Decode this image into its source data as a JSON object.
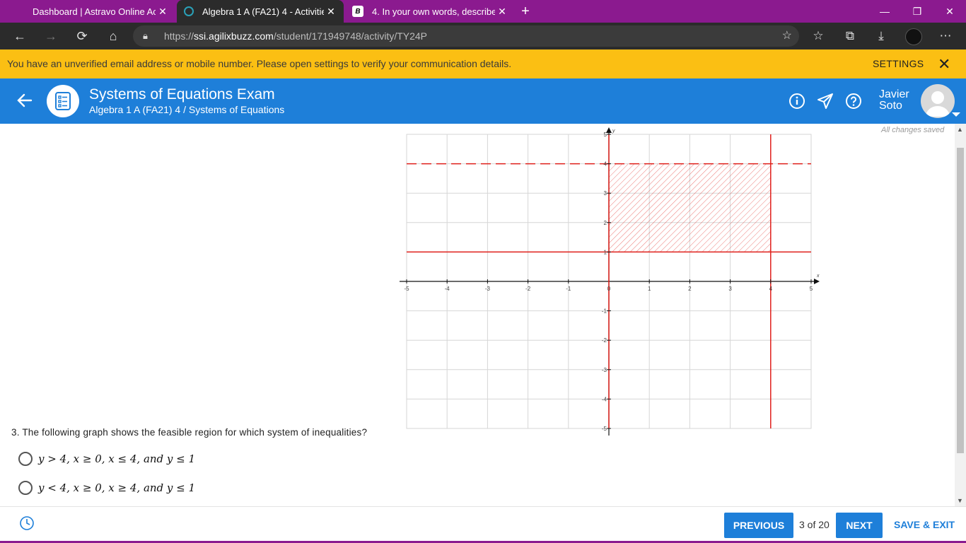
{
  "browser": {
    "tabs": [
      {
        "title": "Dashboard | Astravo Online Acad",
        "active": false
      },
      {
        "title": "Algebra 1 A (FA21) 4 - Activities",
        "active": true
      },
      {
        "title": "4. In your own words, describe h",
        "active": false
      }
    ],
    "url_prefix": "https://",
    "url_host": "ssi.agilixbuzz.com",
    "url_path": "/student/171949748/activity/TY24P",
    "accent_color": "#8b1a8f"
  },
  "notice": {
    "message": "You have an unverified email address or mobile number. Please open settings to verify your communication details.",
    "settings_label": "SETTINGS",
    "color": "#fbbf13"
  },
  "header": {
    "title": "Systems of Equations Exam",
    "breadcrumb": "Algebra 1 A (FA21) 4 / Systems of Equations",
    "user_first": "Javier",
    "user_last": "Soto",
    "color": "#1e7fd9"
  },
  "content": {
    "status": "All changes saved",
    "question": "3. The following graph shows the feasible region for which system of inequalities?",
    "options": [
      "y > 4, x ≥ 0, x ≤ 4,  and y ≤ 1",
      "y < 4, x ≥ 0, x ≥ 4,  and y ≤ 1"
    ]
  },
  "graph": {
    "x_ticks": [
      "-5",
      "-4",
      "-3",
      "-2",
      "-1",
      "0",
      "1",
      "2",
      "3",
      "4",
      "5"
    ],
    "y_ticks": [
      "5",
      "4",
      "3",
      "2",
      "1",
      "-1",
      "-2",
      "-3",
      "-4",
      "-5"
    ],
    "x_axis_label": "x",
    "y_axis_label": "y",
    "xlim": [
      -5,
      5
    ],
    "ylim": [
      -5,
      5
    ],
    "lines": [
      {
        "kind": "horizontal",
        "value": 4,
        "style": "dashed"
      },
      {
        "kind": "horizontal",
        "value": 1,
        "style": "solid"
      },
      {
        "kind": "vertical",
        "value": 0,
        "style": "solid"
      },
      {
        "kind": "vertical",
        "value": 4,
        "style": "solid"
      }
    ],
    "shaded_region": {
      "x": [
        0,
        4
      ],
      "y": [
        1,
        4
      ]
    },
    "line_color": "#e0201b"
  },
  "footer": {
    "previous_label": "PREVIOUS",
    "pager": "3 of 20",
    "next_label": "NEXT",
    "save_exit_label": "SAVE & EXIT"
  }
}
